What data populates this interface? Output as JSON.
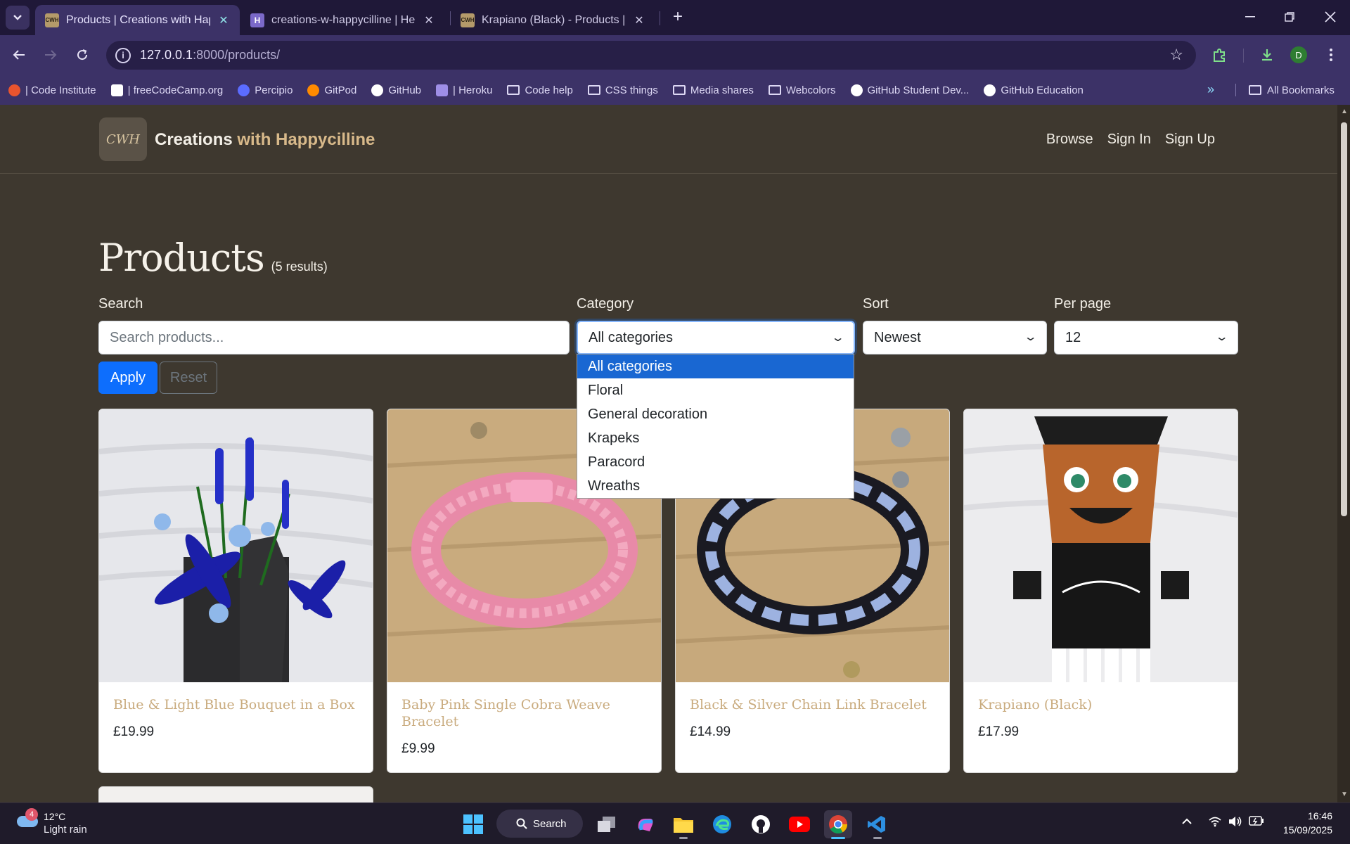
{
  "browser": {
    "tabs": [
      {
        "title": "Products | Creations with Happycilline",
        "favicon": "CWH",
        "active": true
      },
      {
        "title": "creations-w-happycilline | Heroku",
        "favicon": "H",
        "active": false
      },
      {
        "title": "Krapiano (Black) - Products | Creations",
        "favicon": "CWH",
        "active": false
      }
    ],
    "url_host": "127.0.0.1",
    "url_path": ":8000/products/",
    "profile_initial": "D",
    "bookmarks": [
      {
        "label": "| Code Institute",
        "icon": "code-institute-icon",
        "color": "#e8542e"
      },
      {
        "label": "| freeCodeCamp.org",
        "icon": "freecodecamp-icon",
        "color": "#ffffff"
      },
      {
        "label": "Percipio",
        "icon": "percipio-icon",
        "color": "#5b6cff"
      },
      {
        "label": "GitPod",
        "icon": "gitpod-icon",
        "color": "#ff8a00"
      },
      {
        "label": "GitHub",
        "icon": "github-icon",
        "color": "#ffffff"
      },
      {
        "label": "| Heroku",
        "icon": "heroku-icon",
        "color": "#9e8ee6"
      },
      {
        "label": "Code help",
        "icon": "folder-icon",
        "color": ""
      },
      {
        "label": "CSS things",
        "icon": "folder-icon",
        "color": ""
      },
      {
        "label": "Media shares",
        "icon": "folder-icon",
        "color": ""
      },
      {
        "label": "Webcolors",
        "icon": "folder-icon",
        "color": ""
      },
      {
        "label": "GitHub Student Dev...",
        "icon": "github-icon",
        "color": "#ffffff"
      },
      {
        "label": "GitHub Education",
        "icon": "github-icon",
        "color": "#ffffff"
      }
    ],
    "all_bookmarks": "All Bookmarks"
  },
  "site": {
    "logo_text": "CWH",
    "brand_main": "Creations",
    "brand_accent": " with Happycilline",
    "nav": [
      "Browse",
      "Sign In",
      "Sign Up"
    ]
  },
  "products_page": {
    "title": "Products",
    "result_count": "(5 results)",
    "filters": {
      "search_label": "Search",
      "search_placeholder": "Search products...",
      "category_label": "Category",
      "category_value": "All categories",
      "sort_label": "Sort",
      "sort_value": "Newest",
      "per_page_label": "Per page",
      "per_page_value": "12",
      "apply": "Apply",
      "reset": "Reset"
    },
    "category_options": [
      "All categories",
      "Floral",
      "General decoration",
      "Krapeks",
      "Paracord",
      "Wreaths"
    ],
    "products": [
      {
        "name": "Blue & Light Blue Bouquet in a Box",
        "price": "£19.99"
      },
      {
        "name": "Baby Pink Single Cobra Weave Bracelet",
        "price": "£9.99"
      },
      {
        "name": "Black & Silver Chain Link Bracelet",
        "price": "£14.99"
      },
      {
        "name": "Krapiano (Black)",
        "price": "£17.99"
      }
    ]
  },
  "taskbar": {
    "weather_temp": "12°C",
    "weather_desc": "Light rain",
    "weather_badge": "4",
    "search_label": "Search",
    "time": "16:46",
    "date": "15/09/2025"
  },
  "colors": {
    "accent_blue": "#0d6efd",
    "brand_gold": "#d8b98a",
    "page_bg": "#3e382f",
    "chrome_purple": "#3c3267"
  }
}
